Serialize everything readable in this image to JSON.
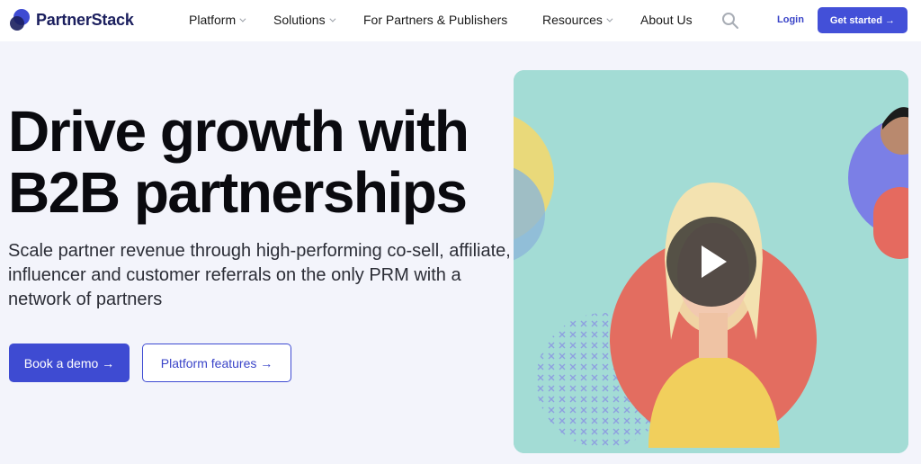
{
  "brand": {
    "name": "PartnerStack",
    "color": "#3e4bd2"
  },
  "nav": {
    "items": [
      {
        "label": "Platform",
        "has_dropdown": true
      },
      {
        "label": "Solutions",
        "has_dropdown": true
      },
      {
        "label": "For Partners & Publishers",
        "has_dropdown": false
      },
      {
        "label": "Resources",
        "has_dropdown": true
      },
      {
        "label": "About Us",
        "has_dropdown": false
      }
    ],
    "search_icon": "search-icon",
    "login_label": "Login",
    "cta_label": "Get started →"
  },
  "hero": {
    "headline_line1": "Drive growth with",
    "headline_line2": "B2B partnerships",
    "subhead": "Scale partner revenue through high-performing co-sell, affiliate, influencer and customer referrals on the only PRM with a network of partners",
    "primary_button": "Book a demo →",
    "secondary_button": "Platform features →"
  },
  "video": {
    "play_icon": "play-icon"
  }
}
